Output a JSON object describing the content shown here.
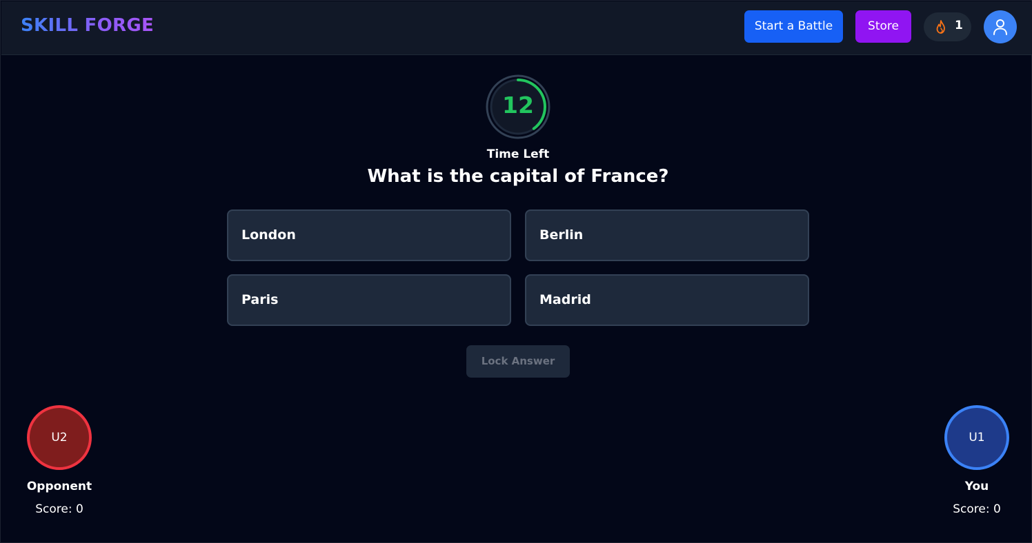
{
  "header": {
    "brand": "SKILL FORGE",
    "start_battle_label": "Start a Battle",
    "store_label": "Store",
    "streak_count": "1",
    "streak_icon": "flame-icon",
    "profile_icon": "user-icon"
  },
  "timer": {
    "seconds": "12",
    "label": "Time Left",
    "remaining_fraction": 0.4
  },
  "question": {
    "text": "What is the capital of France?",
    "options": [
      "London",
      "Berlin",
      "Paris",
      "Madrid"
    ]
  },
  "lock_button_label": "Lock Answer",
  "players": {
    "opponent": {
      "initials": "U2",
      "name": "Opponent",
      "score": "Score: 0"
    },
    "you": {
      "initials": "U1",
      "name": "You",
      "score": "Score: 0"
    }
  },
  "colors": {
    "background": "#030718",
    "navbar": "#111827",
    "battle_button": "#1760f5",
    "store_button": "#9015f2",
    "timer_green": "#22c55e",
    "opponent_ring": "#ef3340",
    "you_ring": "#3b82f6"
  }
}
